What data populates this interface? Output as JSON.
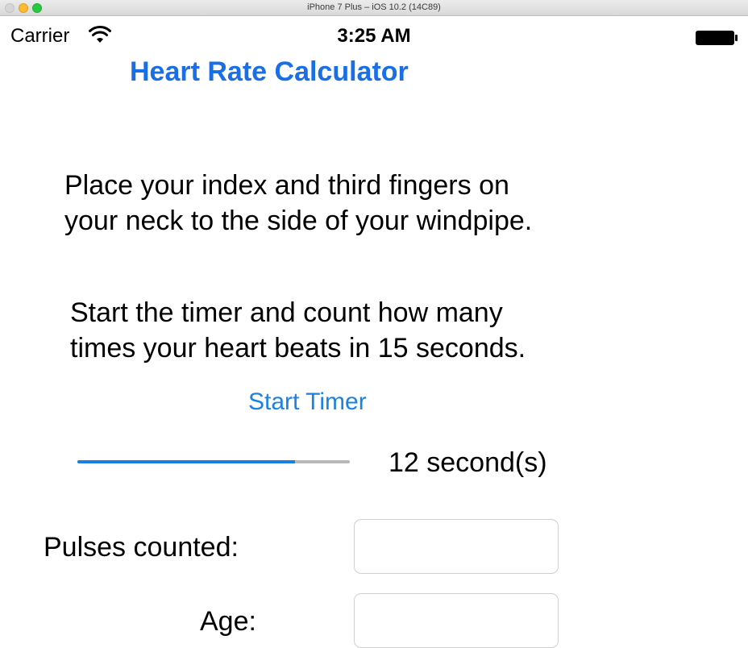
{
  "window": {
    "title": "iPhone 7 Plus – iOS 10.2 (14C89)"
  },
  "status_bar": {
    "carrier": "Carrier",
    "time": "3:25 AM",
    "wifi_icon": "wifi-icon",
    "battery_icon": "battery-icon"
  },
  "app": {
    "title": "Heart Rate Calculator",
    "title_color": "#1a6ee6",
    "accent_color": "#1a82e2"
  },
  "instructions": {
    "line1": "Place your index and third fingers on\nyour neck to the side of your windpipe.",
    "line2": "Start the timer and count how many\ntimes your heart beats in 15 seconds."
  },
  "timer": {
    "button_label": "Start Timer",
    "progress": 0.8,
    "elapsed_label": "12 second(s)"
  },
  "form": {
    "pulses_label": "Pulses counted:",
    "pulses_value": "",
    "age_label": "Age:",
    "age_value": ""
  }
}
